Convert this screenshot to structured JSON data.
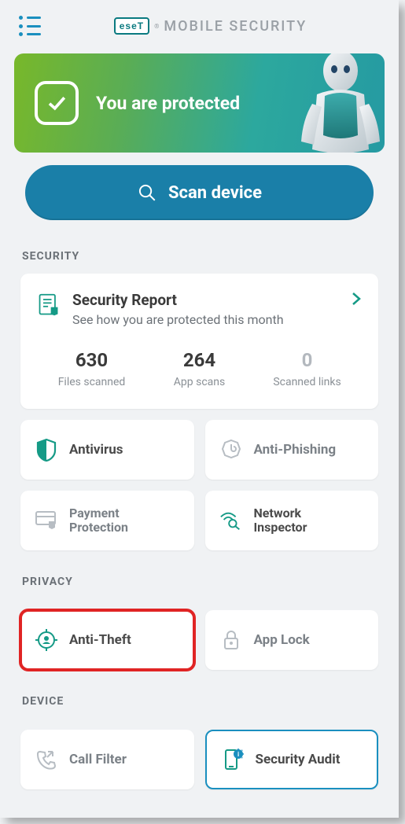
{
  "header": {
    "brand_prefix": "eseT",
    "brand_text": "MOBILE SECURITY"
  },
  "status": {
    "message": "You are protected"
  },
  "scan_button": {
    "label": "Scan device"
  },
  "sections": {
    "security_label": "SECURITY",
    "privacy_label": "PRIVACY",
    "device_label": "DEVICE"
  },
  "report": {
    "title": "Security Report",
    "subtitle": "See how you are protected this month",
    "stats": [
      {
        "value": "630",
        "label": "Files scanned",
        "dim": false
      },
      {
        "value": "264",
        "label": "App scans",
        "dim": false
      },
      {
        "value": "0",
        "label": "Scanned links",
        "dim": true
      }
    ]
  },
  "tiles": {
    "security": [
      {
        "id": "antivirus",
        "label": "Antivirus",
        "icon": "shield-icon",
        "active": true
      },
      {
        "id": "antiphishing",
        "label": "Anti-Phishing",
        "icon": "hook-icon",
        "active": false
      },
      {
        "id": "payment",
        "label": "Payment Protection",
        "icon": "card-icon",
        "active": false,
        "two_line": true
      },
      {
        "id": "network",
        "label": "Network Inspector",
        "icon": "wifi-search-icon",
        "active": true,
        "two_line": true
      }
    ],
    "privacy": [
      {
        "id": "antitheft",
        "label": "Anti-Theft",
        "icon": "crosshair-icon",
        "active": true,
        "highlight": true
      },
      {
        "id": "applock",
        "label": "App Lock",
        "icon": "lock-icon",
        "active": false
      }
    ],
    "device": [
      {
        "id": "callfilter",
        "label": "Call Filter",
        "icon": "phone-icon",
        "active": false
      },
      {
        "id": "audit",
        "label": "Security Audit",
        "icon": "phone-info-icon",
        "active": true,
        "selected": true
      }
    ]
  }
}
